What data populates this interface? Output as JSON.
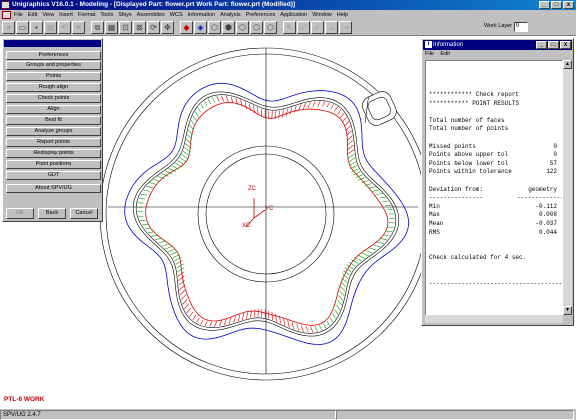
{
  "window": {
    "title": "Unigraphics V16.0.1 - Modeling - [Displayed Part: flower.prt   Work Part: flower.prt (Modified)]",
    "buttons": [
      "_",
      "□",
      "x"
    ]
  },
  "menubar": {
    "items": [
      "File",
      "Edit",
      "View",
      "Insert",
      "Format",
      "Tools",
      "Sfsys",
      "Assemblies",
      "WCS",
      "Information",
      "Analysis",
      "Preferences",
      "Application",
      "Window",
      "Help"
    ]
  },
  "toolbar": {
    "work_layer_label": "Work Layer",
    "work_layer_value": "0",
    "icons": [
      "new-icon",
      "open-icon",
      "save-icon",
      "print-icon",
      "undo-icon",
      "cut-icon",
      "copy-icon",
      "paste-icon",
      "fit-icon",
      "zoom-icon",
      "rotate-icon",
      "pan-icon",
      "refresh-icon",
      "shaded-icon",
      "wireframe-icon",
      "view-icon",
      "view-iso-icon",
      "view-top-icon",
      "view-front-icon",
      "view-right-icon"
    ]
  },
  "spv_panel": {
    "buttons": [
      "Preferences",
      "Groups and properties",
      "Points",
      "Rough align",
      "Check points",
      "Align",
      "Best fit",
      "Analyze groups",
      "Report points",
      "Redisplay points",
      "Point positions",
      "GDT",
      "About SPV/UG"
    ],
    "ok_label": "OK",
    "back_label": "Back",
    "cancel_label": "Cancel"
  },
  "viewport": {
    "triad_labels": {
      "z": "ZC",
      "y": "YC",
      "x": "XC"
    },
    "layer_caption": "PTL-6 WORK"
  },
  "info_window": {
    "title": "Information",
    "menu": [
      "File",
      "Edit"
    ],
    "lines": [
      {
        "text": "************ Check report",
        "value": ""
      },
      {
        "text": "*********** POINT RESULTS",
        "value": ""
      },
      {
        "text": "",
        "value": ""
      },
      {
        "text": "Total number of faces",
        "value": ""
      },
      {
        "text": "Total number of points",
        "value": ""
      },
      {
        "text": "",
        "value": ""
      },
      {
        "text": "Missed points",
        "value": "0"
      },
      {
        "text": "Points above upper tol",
        "value": "0"
      },
      {
        "text": "Points below lower tol",
        "value": "57"
      },
      {
        "text": "Points within tolerance",
        "value": "122"
      },
      {
        "text": "",
        "value": ""
      },
      {
        "text": "Deviation from:",
        "value": "geometry"
      },
      {
        "text": "---------------",
        "value": "--------------"
      },
      {
        "text": "Min",
        "value": "-0.112"
      },
      {
        "text": "Max",
        "value": "0.008"
      },
      {
        "text": "Mean",
        "value": "-0.037"
      },
      {
        "text": "RMS",
        "value": "0.044"
      },
      {
        "text": "",
        "value": ""
      },
      {
        "text": "",
        "value": ""
      },
      {
        "text": "Check calculated for 4 sec.",
        "value": ""
      },
      {
        "text": "",
        "value": ""
      },
      {
        "text": "",
        "value": ""
      },
      {
        "text": "---------------------------------------",
        "value": ""
      }
    ]
  },
  "statusbar": {
    "version": "SPV/UG 2.4.7"
  },
  "colors": {
    "titlebar": "#000080",
    "caption_red": "#c00000",
    "curve_blue": "#0000cc",
    "curve_red": "#dd0000",
    "curve_green": "#00a000"
  }
}
